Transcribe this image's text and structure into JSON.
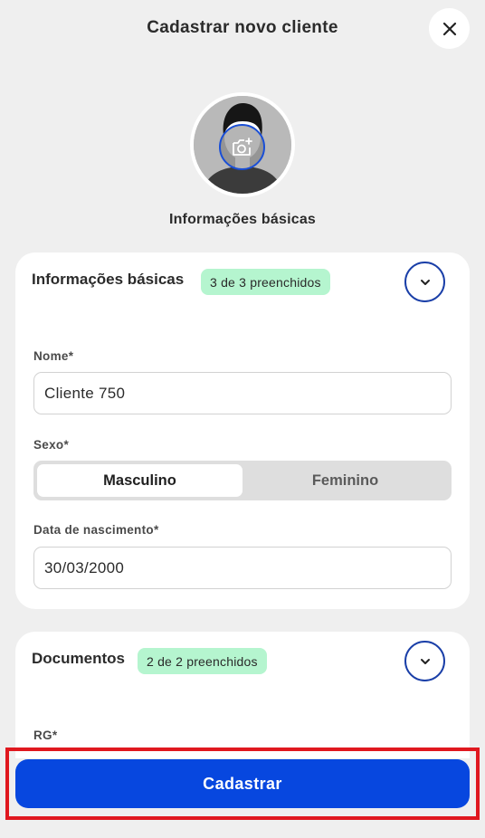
{
  "header": {
    "title": "Cadastrar novo cliente",
    "close_icon": "close-icon"
  },
  "avatar": {
    "caption": "Informações básicas",
    "camera_icon": "camera-add-icon"
  },
  "sections": [
    {
      "title": "Informações básicas",
      "badge": "3 de 3 preenchidos",
      "fields": {
        "nome_label": "Nome*",
        "nome_value": "Cliente 750",
        "sexo_label": "Sexo*",
        "sexo_options": [
          "Masculino",
          "Feminino"
        ],
        "sexo_selected": "Masculino",
        "nascimento_label": "Data de nascimento*",
        "nascimento_value": "30/03/2000"
      }
    },
    {
      "title": "Documentos",
      "badge": "2 de 2 preenchidos",
      "fields": {
        "rg_label": "RG*"
      }
    }
  ],
  "submit": {
    "label": "Cadastrar"
  },
  "colors": {
    "primary": "#0747df",
    "badge_bg": "#b5f5cf",
    "highlight": "#e0181f",
    "background": "#efefef"
  }
}
